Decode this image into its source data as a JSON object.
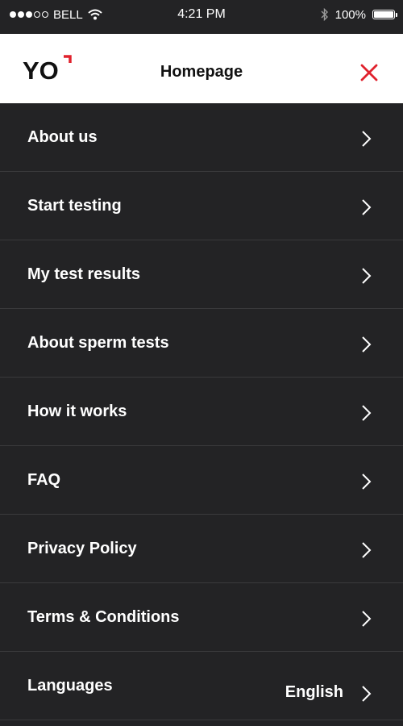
{
  "status_bar": {
    "carrier": "BELL",
    "time": "4:21 PM",
    "battery": "100%",
    "battery_level": 1.0,
    "signal_bars_filled": 3,
    "signal_bars_total": 5
  },
  "header": {
    "logo_text": "YO",
    "title": "Homepage",
    "close_icon": "close-icon",
    "accent_color": "#e0222d"
  },
  "menu": {
    "items": [
      {
        "label": "About us"
      },
      {
        "label": "Start testing"
      },
      {
        "label": "My test results"
      },
      {
        "label": "About sperm tests"
      },
      {
        "label": "How it works"
      },
      {
        "label": "FAQ"
      },
      {
        "label": "Privacy Policy"
      },
      {
        "label": "Terms & Conditions"
      },
      {
        "label": "Languages",
        "value": "English"
      }
    ]
  },
  "colors": {
    "background": "#232325",
    "header_background": "#ffffff",
    "divider": "#3a3a3c",
    "text": "#ffffff"
  }
}
